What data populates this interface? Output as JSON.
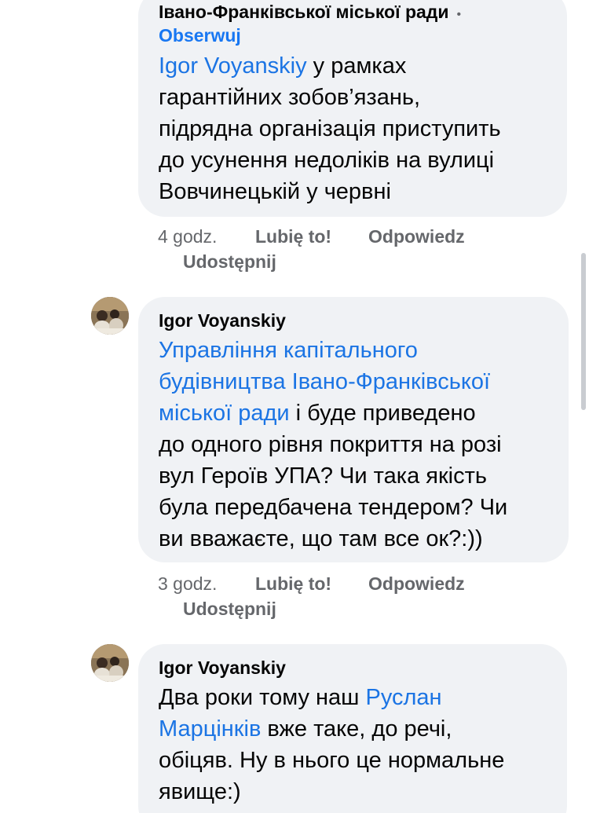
{
  "comment1": {
    "author": "Івано-Франківської міської ради",
    "follow": "Obserwuj",
    "mention": "Igor  Voyanskiy",
    "text_line1": " у рамках",
    "text_line2": "гарантійних зобов’язань,",
    "text_line3": "підрядна організація приступить",
    "text_line4": "до усунення недоліків на вулиці",
    "text_line5": "Вовчинецькій у червні",
    "time": "4 godz.",
    "like": "Lubię to!",
    "reply": "Odpowiedz",
    "share": "Udostępnij"
  },
  "comment2": {
    "author": "Igor  Voyanskiy",
    "mention_line1": "Управління капітального",
    "mention_line2": "будівництва Івано-Франківської",
    "mention_line3": "міської ради",
    "text_line3": " і буде приведено",
    "text_line4": "до одного рівня покриття на розі",
    "text_line5": "вул Героїв УПА? Чи така якість",
    "text_line6": "була передбачена тендером? Чи",
    "text_line7": "ви вважаєте, що там все ок?:))",
    "time": "3 godz.",
    "like": "Lubię to!",
    "reply": "Odpowiedz",
    "share": "Udostępnij"
  },
  "comment3": {
    "author": "Igor  Voyanskiy",
    "text_line1": "Два роки тому наш ",
    "mention_line1": "Руслан",
    "mention_line2": "Марцінків",
    "text_line2": " вже таке, до речі,",
    "text_line3": "обіцяв. Ну в нього це нормальне",
    "text_line4": "явище:)"
  },
  "colors": {
    "bubble": "#f0f2f5",
    "mention": "#1b74e4",
    "follow": "#1877f2",
    "meta": "#65676b"
  }
}
